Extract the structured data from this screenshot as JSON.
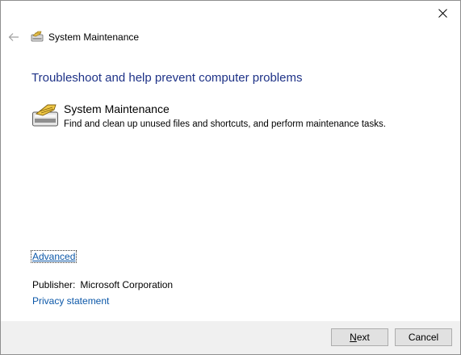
{
  "window": {
    "title": "System Maintenance"
  },
  "main": {
    "heading": "Troubleshoot and help prevent computer problems",
    "item": {
      "title": "System Maintenance",
      "description": "Find and clean up unused files and shortcuts, and perform maintenance tasks."
    },
    "advanced_link": "Advanced",
    "publisher": {
      "label": "Publisher:",
      "value": "Microsoft Corporation"
    },
    "privacy_link": "Privacy statement"
  },
  "footer": {
    "next_mnemonic": "N",
    "next_rest": "ext",
    "cancel_label": "Cancel"
  },
  "icons": {
    "close": "close-icon",
    "back": "back-arrow-icon",
    "title": "system-maintenance-icon",
    "item": "system-maintenance-icon"
  },
  "colors": {
    "heading": "#1e3287",
    "link": "#0b57a8",
    "footer_bg": "#f0f0f0",
    "button_bg": "#e1e1e1"
  }
}
